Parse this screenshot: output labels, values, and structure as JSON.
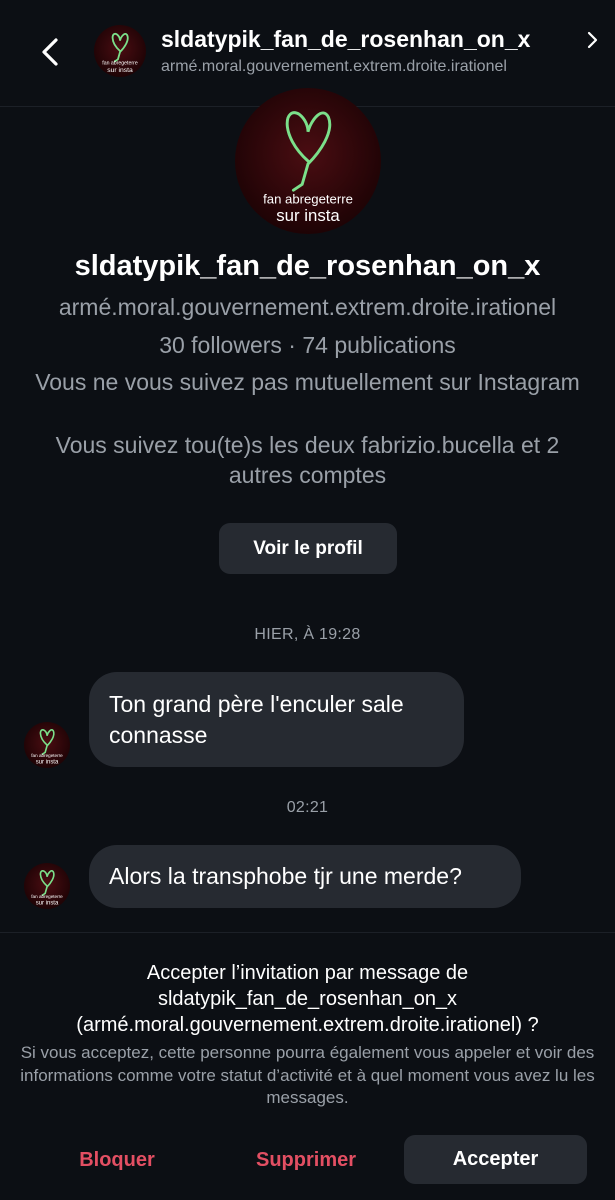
{
  "colors": {
    "background": "#0c0f14",
    "bubble": "#262a31",
    "secondary_text": "#9aa0a8",
    "danger": "#e34f63",
    "avatar_bg": "#3a0a0e",
    "heart": "#7be08a"
  },
  "header": {
    "back_icon": "chevron-left-icon",
    "title": "sldatypik_fan_de_rosenhan_on_x",
    "subtitle": "armé.moral.gouvernement.extrem.droite.irationel",
    "chevron_icon": "chevron-right-icon"
  },
  "avatar": {
    "line1": "fan abregeterre",
    "line2": "sur insta"
  },
  "profile": {
    "name": "sldatypik_fan_de_rosenhan_on_x",
    "handle": "armé.moral.gouvernement.extrem.droite.irationel",
    "stats": "30 followers · 74 publications",
    "mutual_note": "Vous ne vous suivez pas mutuellement sur Instagram",
    "common_note": "Vous suivez tou(te)s les deux fabrizio.bucella et 2 autres comptes",
    "view_profile_label": "Voir le profil"
  },
  "messages": [
    {
      "timestamp": "HIER, À 19:28",
      "text": "Ton grand père l'enculer sale connasse"
    },
    {
      "timestamp": "02:21",
      "text": "Alors la transphobe tjr une merde?"
    }
  ],
  "request": {
    "title": "Accepter l’invitation par message de sldatypik_fan_de_rosenhan_on_x (armé.moral.gouvernement.extrem.droite.irationel) ?",
    "description": "Si vous acceptez, cette personne pourra également vous appeler et voir des informations comme votre statut d’activité et à quel moment vous avez lu les messages.",
    "block_label": "Bloquer",
    "delete_label": "Supprimer",
    "accept_label": "Accepter"
  }
}
